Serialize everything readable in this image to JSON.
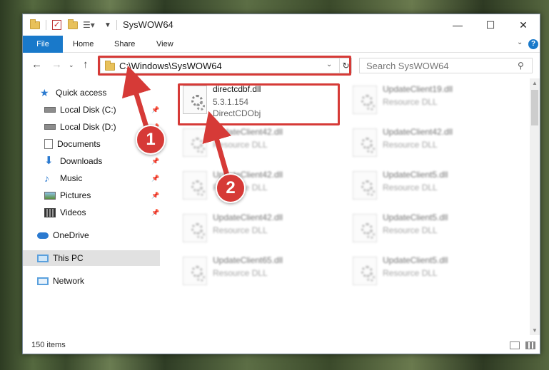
{
  "window": {
    "title": "SysWOW64",
    "minimize": "—",
    "maximize": "☐",
    "close": "✕"
  },
  "ribbon": {
    "file_tab": "File",
    "tabs": [
      "Home",
      "Share",
      "View"
    ],
    "help": "?"
  },
  "address": {
    "path": "C:\\Windows\\SysWOW64"
  },
  "search": {
    "placeholder": "Search SysWOW64"
  },
  "sidebar": {
    "items": [
      {
        "label": "Quick access",
        "icon": "star-icon"
      },
      {
        "label": "Local Disk (C:)",
        "icon": "drive-icon"
      },
      {
        "label": "Local Disk (D:)",
        "icon": "drive-icon"
      },
      {
        "label": "Documents",
        "icon": "documents-icon"
      },
      {
        "label": "Downloads",
        "icon": "downloads-icon"
      },
      {
        "label": "Music",
        "icon": "music-icon"
      },
      {
        "label": "Pictures",
        "icon": "pictures-icon"
      },
      {
        "label": "Videos",
        "icon": "videos-icon"
      },
      {
        "label": "OneDrive",
        "icon": "cloud-icon"
      },
      {
        "label": "This PC",
        "icon": "pc-icon"
      },
      {
        "label": "Network",
        "icon": "network-icon"
      }
    ]
  },
  "files": [
    {
      "name": "directcdbf.dll",
      "version": "5.3.1.154",
      "description": "DirectCDObj"
    },
    {
      "name": "UpdateClient19.dll",
      "description": "Resource DLL"
    },
    {
      "name": "UpdateClient42.dll",
      "description": "Resource DLL"
    },
    {
      "name": "UpdateClient42.dll",
      "description": "Resource DLL"
    },
    {
      "name": "UpdateClient42.dll",
      "description": "Resource DLL"
    },
    {
      "name": "UpdateClient5.dll",
      "description": "Resource DLL"
    },
    {
      "name": "UpdateClient42.dll",
      "description": "Resource DLL"
    },
    {
      "name": "UpdateClient5.dll",
      "description": "Resource DLL"
    },
    {
      "name": "UpdateClient65.dll",
      "description": "Resource DLL"
    },
    {
      "name": "UpdateClient5.dll",
      "description": "Resource DLL"
    }
  ],
  "status": {
    "item_count": "150 items"
  },
  "annotations": {
    "step1": "1",
    "step2": "2",
    "color": "#d63a37"
  }
}
